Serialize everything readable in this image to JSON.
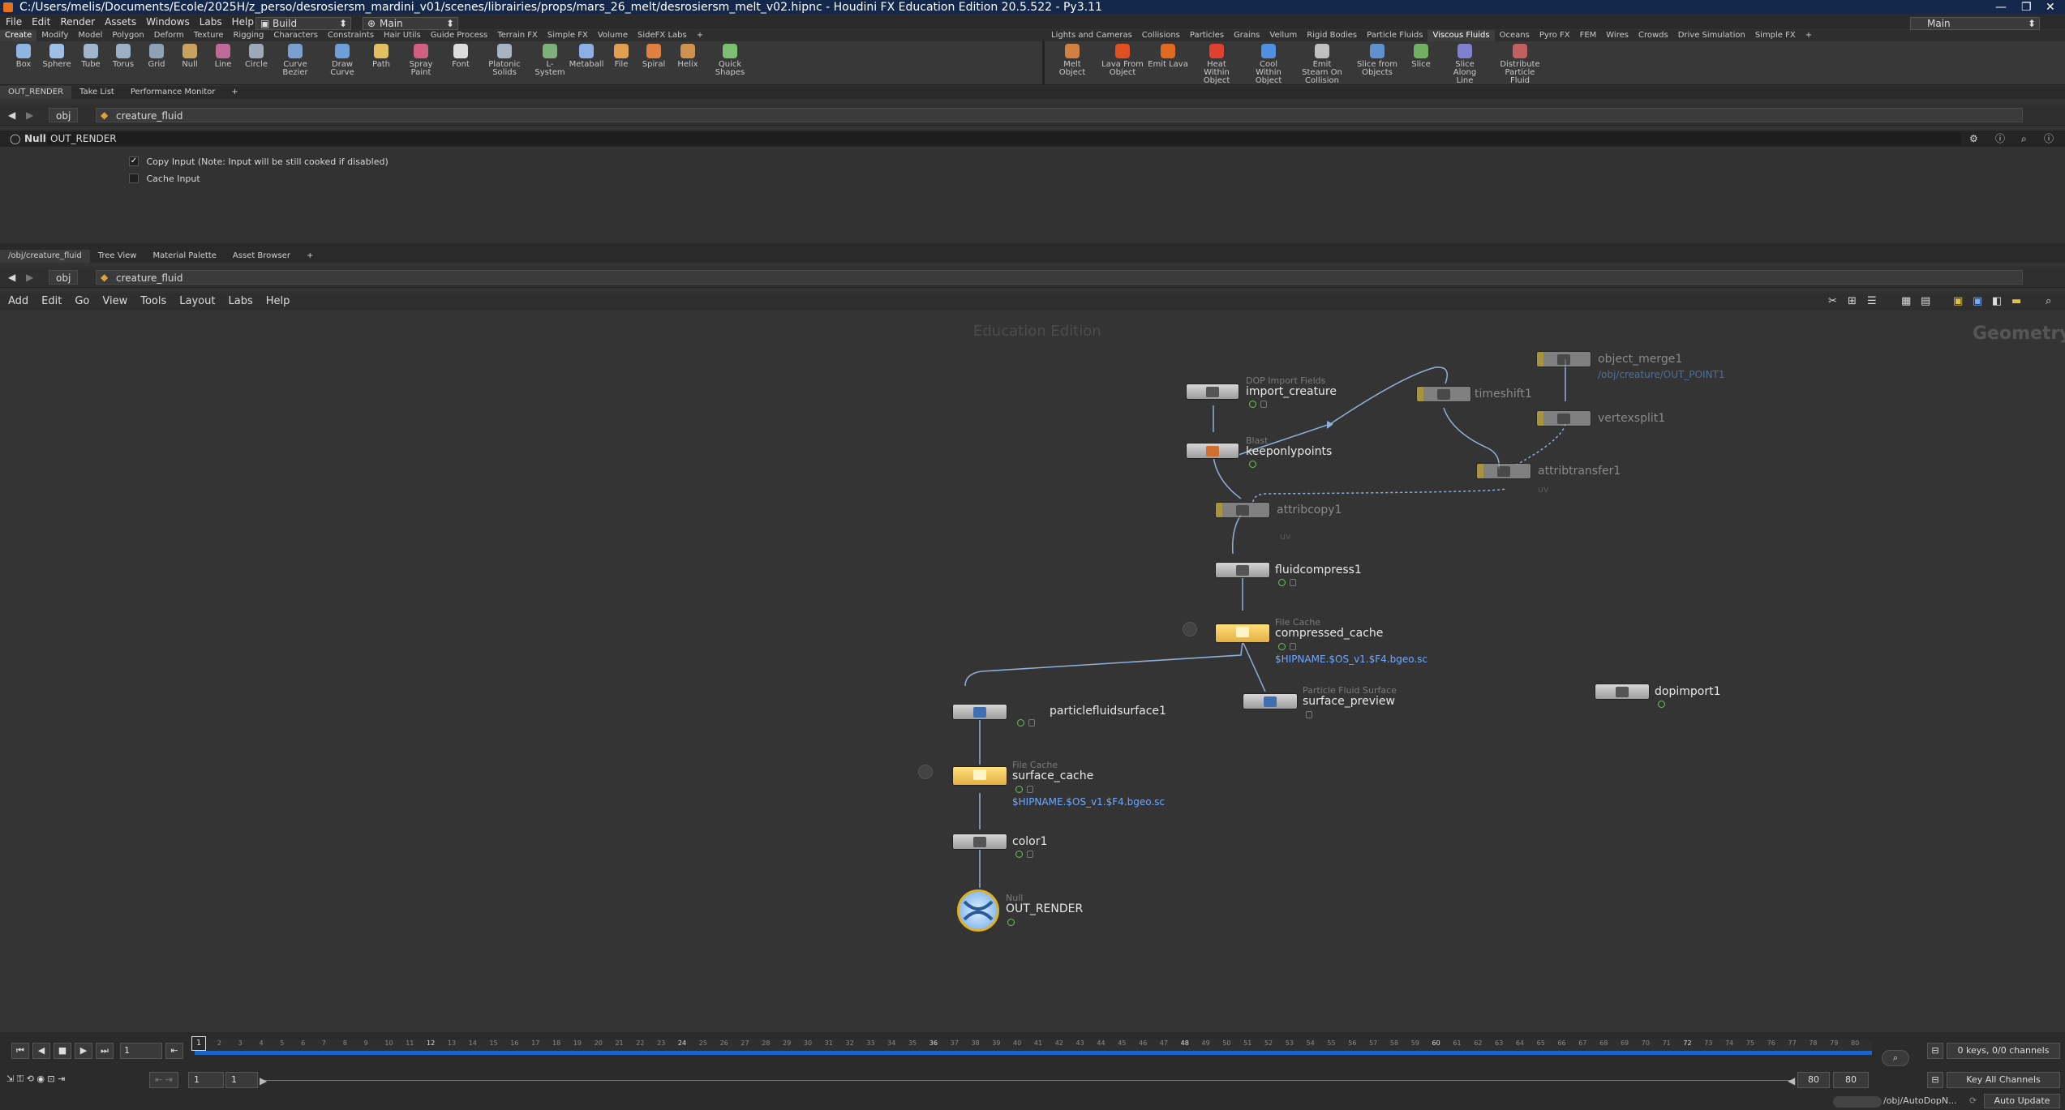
{
  "window": {
    "title": "C:/Users/melis/Documents/Ecole/2025H/z_perso/desrosiersm_mardini_v01/scenes/librairies/props/mars_26_melt/desrosiersm_melt_v02.hipnc - Houdini FX Education Edition 20.5.522 - Py3.11"
  },
  "menubar": {
    "items": [
      "File",
      "Edit",
      "Render",
      "Assets",
      "Windows",
      "Labs",
      "Help"
    ],
    "desktop": "Build",
    "desktop2": "Main",
    "right_desktop": "Main"
  },
  "shelf": {
    "tabs_left": [
      "Create",
      "Modify",
      "Model",
      "Polygon",
      "Deform",
      "Texture",
      "Rigging",
      "Characters",
      "Constraints",
      "Hair Utils",
      "Guide Process",
      "Terrain FX",
      "Simple FX",
      "Volume",
      "SideFX Labs",
      "+"
    ],
    "tabs_right": [
      "Lights and Cameras",
      "Collisions",
      "Particles",
      "Grains",
      "Vellum",
      "Rigid Bodies",
      "Particle Fluids",
      "Viscous Fluids",
      "Oceans",
      "Pyro FX",
      "FEM",
      "Wires",
      "Crowds",
      "Drive Simulation",
      "Simple FX",
      "+"
    ],
    "tools_left": [
      {
        "label": "Box",
        "color": "#8fb6e0"
      },
      {
        "label": "Sphere",
        "color": "#9fc0e6"
      },
      {
        "label": "Tube",
        "color": "#a0b6cc"
      },
      {
        "label": "Torus",
        "color": "#9eb0c6"
      },
      {
        "label": "Grid",
        "color": "#8ea1b6"
      },
      {
        "label": "Null",
        "color": "#c9a25f"
      },
      {
        "label": "Line",
        "color": "#c06a9a"
      },
      {
        "label": "Circle",
        "color": "#9da9b8"
      },
      {
        "label": "Curve Bezier",
        "color": "#7aa0d0"
      },
      {
        "label": "Draw Curve",
        "color": "#6d9fd9"
      },
      {
        "label": "Path",
        "color": "#e0c060"
      },
      {
        "label": "Spray Paint",
        "color": "#d06080"
      },
      {
        "label": "Font",
        "color": "#dddddd"
      },
      {
        "label": "Platonic Solids",
        "color": "#a7b4c4"
      },
      {
        "label": "L-System",
        "color": "#7db07a"
      },
      {
        "label": "Metaball",
        "color": "#8cb0e6"
      },
      {
        "label": "File",
        "color": "#e0a050"
      },
      {
        "label": "Spiral",
        "color": "#e08040"
      },
      {
        "label": "Helix",
        "color": "#d09050"
      },
      {
        "label": "Quick Shapes",
        "color": "#7bc070"
      }
    ],
    "tools_right": [
      {
        "label": "Melt Object",
        "color": "#d08040"
      },
      {
        "label": "Lava From Object",
        "color": "#e05020"
      },
      {
        "label": "Emit Lava",
        "color": "#e06a20"
      },
      {
        "label": "Heat Within Object",
        "color": "#e04030"
      },
      {
        "label": "Cool Within Object",
        "color": "#5090e0"
      },
      {
        "label": "Emit Steam On Collision",
        "color": "#c0c0c0"
      },
      {
        "label": "Slice from Objects",
        "color": "#6090d0"
      },
      {
        "label": "Slice",
        "color": "#70b060"
      },
      {
        "label": "Slice Along Line",
        "color": "#8080d0"
      },
      {
        "label": "Distribute Particle Fluid",
        "color": "#c06060"
      }
    ]
  },
  "top_pane": {
    "tabs": [
      "OUT_RENDER",
      "Take List",
      "Performance Monitor",
      "+"
    ],
    "path_root": "obj",
    "path_node": "creature_fluid",
    "node_type": "Null",
    "node_name": "OUT_RENDER",
    "params": [
      {
        "label": "Copy Input (Note: Input will be still cooked if disabled)",
        "checked": true
      },
      {
        "label": "Cache Input",
        "checked": false
      }
    ]
  },
  "network_pane": {
    "tabs": [
      "/obj/creature_fluid",
      "Tree View",
      "Material Palette",
      "Asset Browser",
      "+"
    ],
    "path_root": "obj",
    "path_node": "creature_fluid",
    "menu": [
      "Add",
      "Edit",
      "Go",
      "View",
      "Tools",
      "Layout",
      "Labs",
      "Help"
    ],
    "watermark": "Education Edition",
    "context_label": "Geometry"
  },
  "nodes": {
    "import_creature": {
      "type": "DOP Import Fields",
      "name": "import_creature"
    },
    "keeponlypoints": {
      "type": "Blast",
      "name": "keeponlypoints"
    },
    "object_merge1": {
      "name": "object_merge1",
      "path": "/obj/creature/OUT_POINT1"
    },
    "timeshift1": {
      "name": "timeshift1"
    },
    "vertexsplit1": {
      "name": "vertexsplit1"
    },
    "attribtransfer1": {
      "name": "attribtransfer1",
      "sub": "uv"
    },
    "attribcopy1": {
      "name": "attribcopy1",
      "sub": "uv"
    },
    "fluidcompress1": {
      "name": "fluidcompress1"
    },
    "compressed_cache": {
      "type": "File Cache",
      "name": "compressed_cache",
      "path": "$HIPNAME.$OS_v1.$F4.bgeo.sc"
    },
    "particlefluidsurface1": {
      "name": "particlefluidsurface1"
    },
    "surface_preview": {
      "type": "Particle Fluid Surface",
      "name": "surface_preview"
    },
    "dopimport1": {
      "name": "dopimport1"
    },
    "surface_cache": {
      "type": "File Cache",
      "name": "surface_cache",
      "path": "$HIPNAME.$OS_v1.$F4.bgeo.sc"
    },
    "color1": {
      "name": "color1"
    },
    "out_render": {
      "type": "Null",
      "name": "OUT_RENDER"
    }
  },
  "timeline": {
    "current_frame": "1",
    "start": "1",
    "range_start": "1",
    "range_end": "80",
    "end": "80",
    "frame_marker": "1",
    "keys_info": "0 keys, 0/0 channels",
    "key_all": "Key All Channels",
    "status_path": "/obj/AutoDopN...",
    "auto_update": "Auto Update"
  }
}
